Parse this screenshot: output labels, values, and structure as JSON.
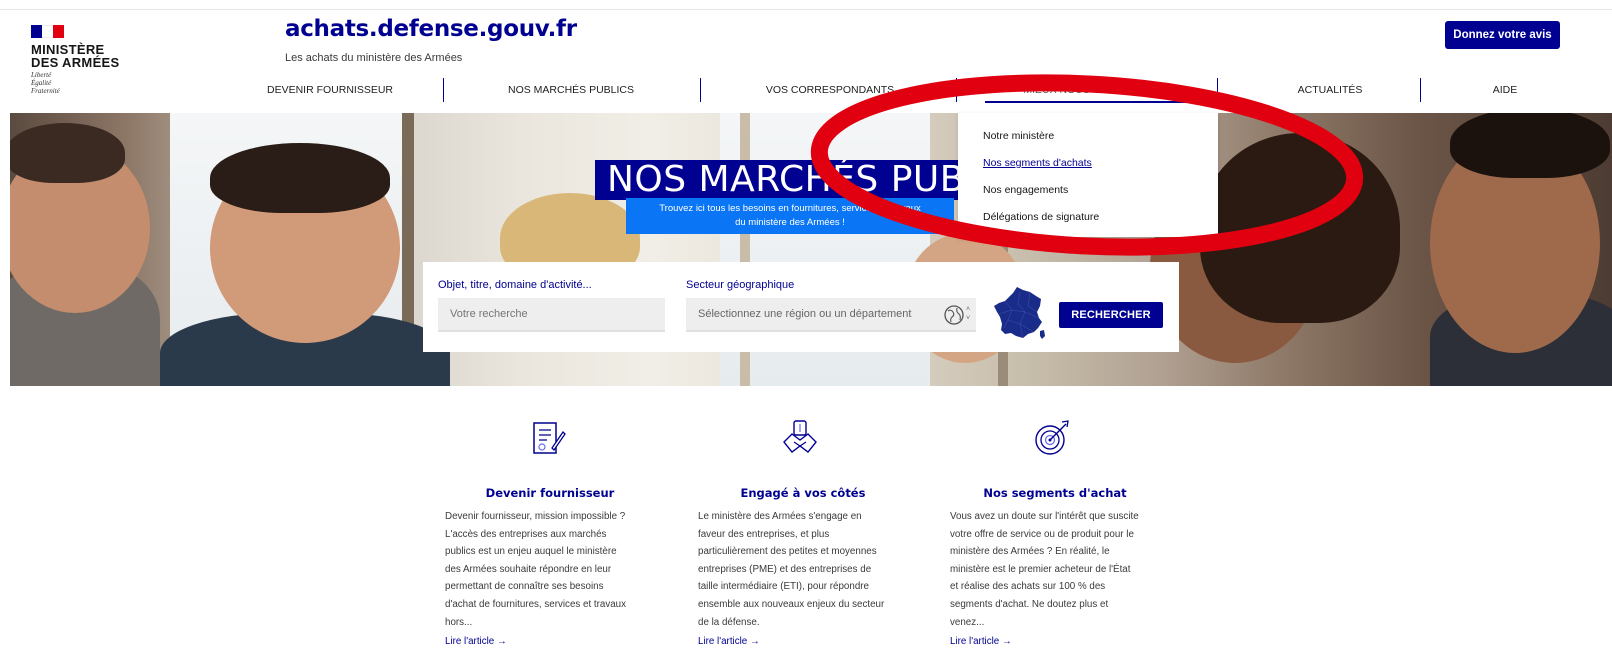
{
  "brand": {
    "ministry_line1": "MINISTÈRE",
    "ministry_line2": "DES ARMÉES",
    "devise": [
      "Liberté",
      "Égalité",
      "Fraternité"
    ],
    "flag_colors": [
      "#000091",
      "#ffffff",
      "#e1000f"
    ]
  },
  "header": {
    "site_title": "achats.defense.gouv.fr",
    "site_subtitle": "Les achats du ministère des Armées",
    "feedback_button": "Donnez votre avis"
  },
  "nav": {
    "items": [
      {
        "label": "DEVENIR FOURNISSEUR"
      },
      {
        "label": "NOS MARCHÉS PUBLICS"
      },
      {
        "label": "VOS CORRESPONDANTS"
      },
      {
        "label": "MIEUX NOUS CONNAÎTRE",
        "active": true
      },
      {
        "label": "ACTUALITÉS"
      },
      {
        "label": "AIDE"
      }
    ]
  },
  "dropdown": {
    "items": [
      {
        "label": "Notre ministère"
      },
      {
        "label": "Nos segments d'achats",
        "active": true
      },
      {
        "label": "Nos engagements"
      },
      {
        "label": "Délégations de signature"
      }
    ]
  },
  "hero": {
    "title": "NOS MARCHÉS PUBLICS",
    "subtitle_line1": "Trouvez ici tous les besoins en fournitures, services et travaux",
    "subtitle_line2": "du ministère des Armées !"
  },
  "search": {
    "keyword_label": "Objet, titre, domaine d'activité...",
    "keyword_placeholder": "Votre recherche",
    "region_label": "Secteur géographique",
    "region_placeholder": "Sélectionnez une région ou un département",
    "button": "RECHERCHER"
  },
  "cards": [
    {
      "icon": "contract-signature-icon",
      "title": "Devenir fournisseur",
      "text": "Devenir fournisseur, mission impossible ?\nL'accès des entreprises aux marchés\npublics est un enjeu auquel le ministère\ndes Armées souhaite répondre en leur\npermettant de connaître ses besoins\nd'achat de fournitures, services et travaux\nhors...",
      "link": "Lire l'article →"
    },
    {
      "icon": "handshake-icon",
      "title": "Engagé à vos côtés",
      "text": "Le ministère des Armées s'engage en\nfaveur des entreprises, et plus\nparticulièrement des petites et moyennes\nentreprises (PME) et des entreprises de\ntaille intermédiaire (ETI), pour répondre\nensemble aux nouveaux enjeux du secteur\nde la défense.",
      "link": "Lire l'article →"
    },
    {
      "icon": "target-icon",
      "title": "Nos segments d'achat",
      "text": "Vous avez un doute sur l'intérêt que suscite\nvotre offre de service ou de produit pour le\nministère des Armées ? En réalité, le\nministère est le premier acheteur de l'État\net réalise des achats sur 100 % des\nsegments d'achat. Ne doutez plus et\nvenez...",
      "link": "Lire l'article →"
    }
  ],
  "colors": {
    "primary": "#000091",
    "accent_blue": "#0a76f6",
    "annotation_red": "#e1000f"
  }
}
